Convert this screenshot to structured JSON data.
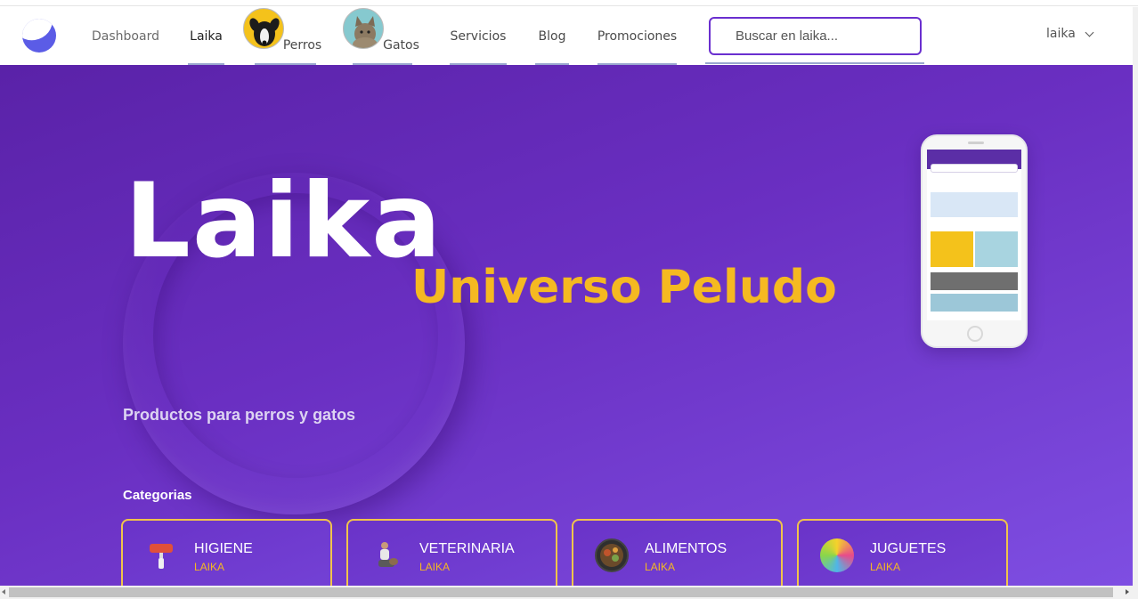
{
  "nav": {
    "items": [
      {
        "label": "Dashboard"
      },
      {
        "label": "Laika"
      },
      {
        "label": "Perros"
      },
      {
        "label": "Gatos"
      },
      {
        "label": "Servicios"
      },
      {
        "label": "Blog"
      },
      {
        "label": "Promociones"
      }
    ],
    "search_placeholder": "Buscar en laika...",
    "user_label": "laika"
  },
  "hero": {
    "title": "Laika",
    "subtitle": "Universo Peludo",
    "tagline": "Productos para perros y gatos"
  },
  "categories": {
    "heading": "Categorias",
    "items": [
      {
        "name": "HIGIENE",
        "brand": "LAIKA",
        "icon": "hygiene-roller-icon"
      },
      {
        "name": "VETERINARIA",
        "brand": "LAIKA",
        "icon": "veterinarian-icon"
      },
      {
        "name": "ALIMENTOS",
        "brand": "LAIKA",
        "icon": "food-bowl-icon"
      },
      {
        "name": "JUGUETES",
        "brand": "LAIKA",
        "icon": "toy-ball-icon"
      }
    ]
  },
  "colors": {
    "hero_bg": "#6a2fc2",
    "accent_yellow": "#f5b921",
    "search_border": "#6a2fcf",
    "card_border": "#f1c44a"
  }
}
